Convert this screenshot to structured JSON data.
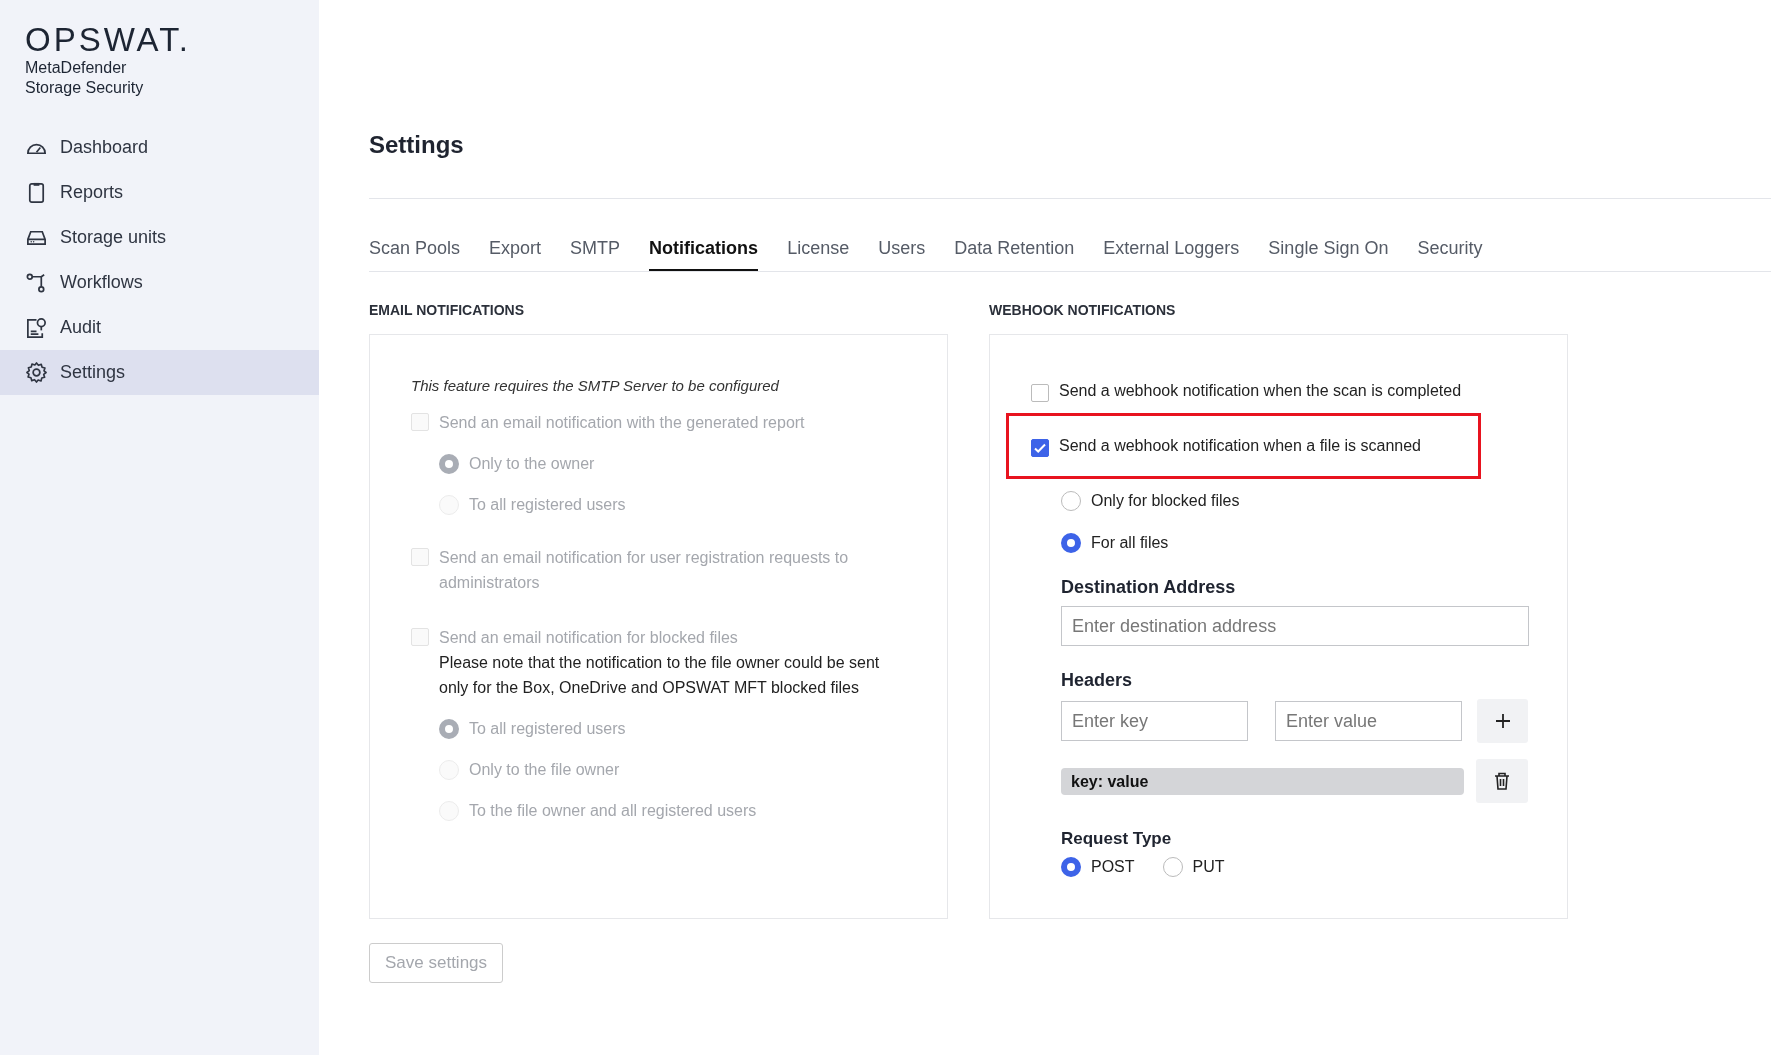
{
  "brand": {
    "logo": "OPSWAT.",
    "product_lines": [
      "MetaDefender",
      "Storage Security"
    ]
  },
  "sidebar": {
    "items": [
      {
        "label": "Dashboard",
        "kind": "gauge",
        "selected": false
      },
      {
        "label": "Reports",
        "kind": "clipboard",
        "selected": false
      },
      {
        "label": "Storage units",
        "kind": "drive",
        "selected": false
      },
      {
        "label": "Workflows",
        "kind": "flow",
        "selected": false
      },
      {
        "label": "Audit",
        "kind": "audit",
        "selected": false
      },
      {
        "label": "Settings",
        "kind": "gear",
        "selected": true
      }
    ]
  },
  "page": {
    "title": "Settings"
  },
  "tabs": [
    {
      "label": "Scan Pools",
      "selected": false
    },
    {
      "label": "Export",
      "selected": false
    },
    {
      "label": "SMTP",
      "selected": false
    },
    {
      "label": "Notifications",
      "selected": true
    },
    {
      "label": "License",
      "selected": false
    },
    {
      "label": "Users",
      "selected": false
    },
    {
      "label": "Data Retention",
      "selected": false
    },
    {
      "label": "External Loggers",
      "selected": false
    },
    {
      "label": "Single Sign On",
      "selected": false
    },
    {
      "label": "Security",
      "selected": false
    }
  ],
  "email": {
    "heading": "EMAIL NOTIFICATIONS",
    "note": "This feature requires the SMTP Server to be configured",
    "options": [
      {
        "label": "Send an email notification with the generated report",
        "checked": false,
        "disabled": true,
        "choices": [
          {
            "label": "Only to the owner",
            "selected": true,
            "disabled": true
          },
          {
            "label": "To all registered users",
            "selected": false,
            "disabled": true
          }
        ]
      },
      {
        "label": "Send an email notification for user registration requests to administrators",
        "checked": false,
        "disabled": true
      },
      {
        "label": "Send an email notification for blocked files",
        "checked": false,
        "disabled": true,
        "description": "Please note that the notification to the file owner could be sent only for the Box, OneDrive and OPSWAT MFT blocked files",
        "choices": [
          {
            "label": "To all registered users",
            "selected": true,
            "disabled": true
          },
          {
            "label": "Only to the file owner",
            "selected": false,
            "disabled": true
          },
          {
            "label": "To the file owner and all registered users",
            "selected": false,
            "disabled": true
          }
        ]
      }
    ]
  },
  "webhook": {
    "heading": "WEBHOOK NOTIFICATIONS",
    "options": [
      {
        "label": "Send a webhook notification when the scan is completed",
        "checked": false,
        "highlighted": false
      },
      {
        "label": "Send a webhook notification when a file is scanned",
        "checked": true,
        "highlighted": true
      }
    ],
    "choices": [
      {
        "label": "Only for blocked files",
        "selected": false
      },
      {
        "label": "For all files",
        "selected": true
      }
    ],
    "destination": {
      "label": "Destination Address",
      "placeholder": "Enter destination address"
    },
    "headers": {
      "label": "Headers",
      "key_placeholder": "Enter key",
      "value_placeholder": "Enter value",
      "entries": [
        "key: value"
      ]
    },
    "request_type": {
      "label": "Request Type",
      "options": [
        {
          "label": "POST",
          "selected": true
        },
        {
          "label": "PUT",
          "selected": false
        }
      ]
    }
  },
  "save_button": {
    "label": "Save settings",
    "disabled": true
  }
}
